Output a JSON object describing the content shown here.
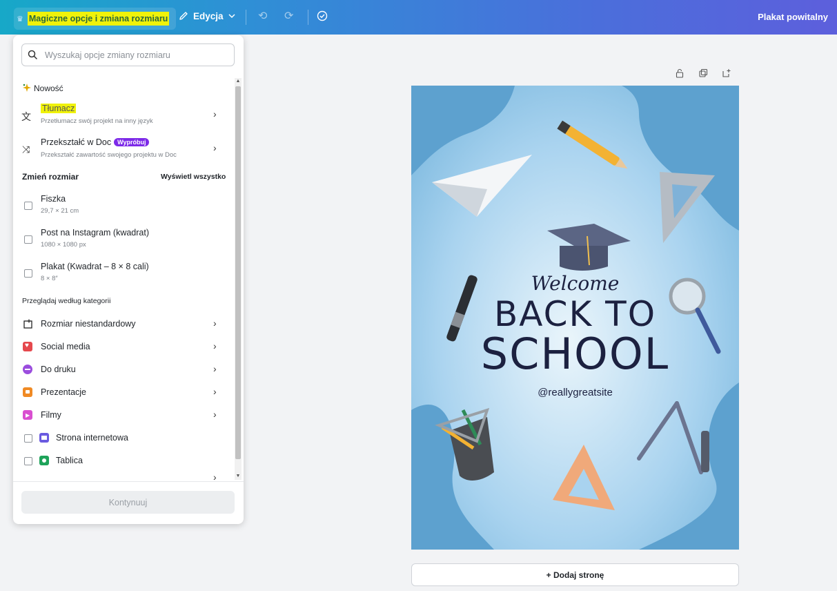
{
  "topbar": {
    "resize_label": "Magiczne opcje i zmiana rozmiaru",
    "edit_label": "Edycja",
    "doc_title": "Plakat powitalny"
  },
  "panel": {
    "search_placeholder": "Wyszukaj opcje zmiany rozmiaru",
    "new_section": "Nowość",
    "translator": {
      "title": "Tłumacz",
      "subtitle": "Przetłumacz swój projekt na inny język"
    },
    "to_doc": {
      "title": "Przekształć w Doc",
      "badge": "Wypróbuj",
      "subtitle": "Przekształć zawartość swojego projektu w Doc"
    },
    "resize_section": "Zmień rozmiar",
    "show_all": "Wyświetl wszystko",
    "sizes": [
      {
        "title": "Fiszka",
        "dims": "29,7 × 21 cm"
      },
      {
        "title": "Post na Instagram (kwadrat)",
        "dims": "1080 × 1080 px"
      },
      {
        "title": "Plakat (Kwadrat – 8 × 8 cali)",
        "dims": "8 × 8″"
      }
    ],
    "browse_section": "Przeglądaj według kategorii",
    "categories": [
      {
        "label": "Rozmiar niestandardowy",
        "icon": "custom-size-icon"
      },
      {
        "label": "Social media",
        "icon": "heart-icon",
        "color": "#e5484d"
      },
      {
        "label": "Do druku",
        "icon": "print-icon",
        "color": "#9b4dde"
      },
      {
        "label": "Prezentacje",
        "icon": "presentation-icon",
        "color": "#f08a24"
      },
      {
        "label": "Filmy",
        "icon": "video-icon",
        "color": "#d94fd0"
      },
      {
        "label": "Strona internetowa",
        "icon": "website-icon",
        "color": "#6a5ae0"
      },
      {
        "label": "Tablica",
        "icon": "whiteboard-icon",
        "color": "#1ea35a"
      }
    ],
    "continue_label": "Kontynuuj"
  },
  "poster": {
    "welcome": "Welcome",
    "line1": "BACK TO",
    "line2": "SCHOOL",
    "handle": "@reallygreatsite"
  },
  "add_page_label": "+ Dodaj stronę"
}
